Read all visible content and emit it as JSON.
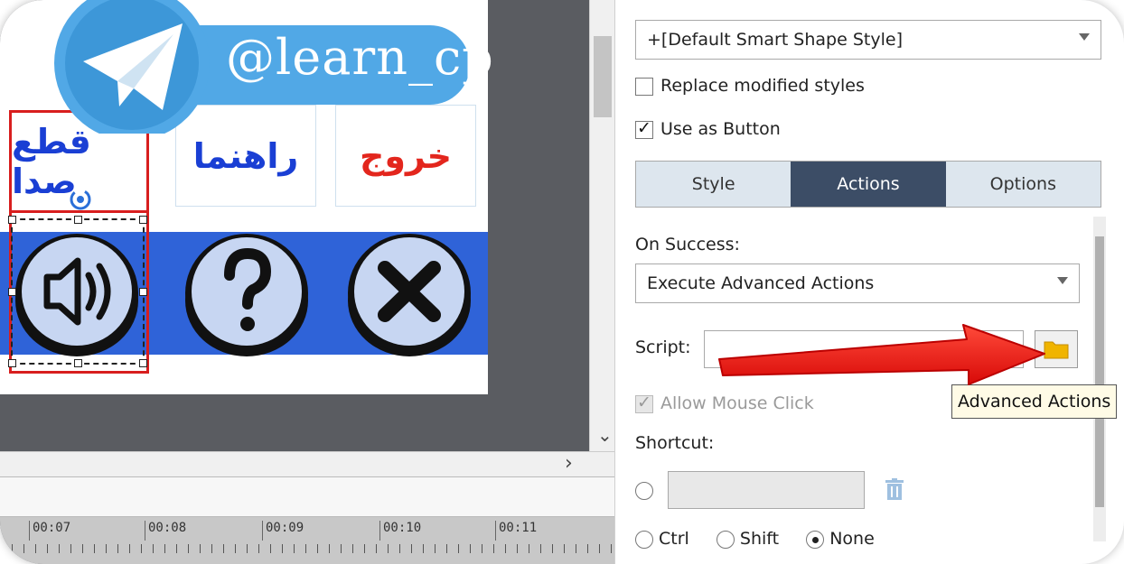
{
  "stage": {
    "banner_text": "@learn_cp",
    "labels": {
      "mute": "قطع صدا",
      "help": "راهنما",
      "exit": "خروج"
    },
    "icons": [
      "speaker-icon",
      "question-icon",
      "close-icon"
    ],
    "colors": {
      "band": "#2f63d8",
      "mute_label": "#1a3fd4",
      "help_label": "#1a3fd4",
      "exit_label": "#e3261d",
      "selection": "#d81e1e",
      "telegram": "#51a8e6"
    }
  },
  "timeline": {
    "ticks": [
      "00:07",
      "00:08",
      "00:09",
      "00:10",
      "00:11"
    ]
  },
  "properties": {
    "style_select": "+[Default Smart Shape Style]",
    "replace_modified_label": "Replace modified styles",
    "replace_modified_checked": false,
    "use_as_button_label": "Use as Button",
    "use_as_button_checked": true,
    "tabs": [
      {
        "label": "Style",
        "active": false
      },
      {
        "label": "Actions",
        "active": true
      },
      {
        "label": "Options",
        "active": false
      }
    ],
    "on_success_label": "On Success:",
    "on_success_value": "Execute Advanced Actions",
    "script_label": "Script:",
    "tooltip": "Advanced Actions",
    "allow_mouse_click_label": "Allow Mouse Click",
    "allow_mouse_click_checked": true,
    "shortcut_label": "Shortcut:",
    "modifiers": [
      {
        "label": "Ctrl",
        "selected": false
      },
      {
        "label": "Shift",
        "selected": false
      },
      {
        "label": "None",
        "selected": true
      }
    ],
    "colors": {
      "active_tab": "#3c4d66",
      "folder": "#f0b400",
      "arrow": "#e8130f"
    }
  }
}
